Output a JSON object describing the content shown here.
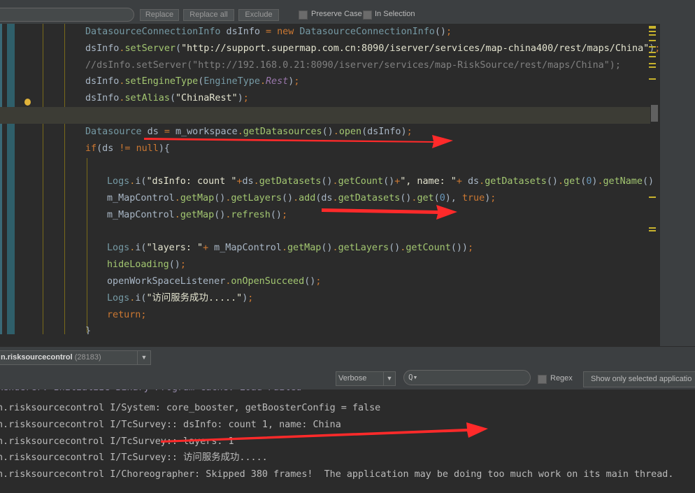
{
  "findbar": {
    "replace_label": "Replace",
    "replace_all_label": "Replace all",
    "exclude_label": "Exclude",
    "preserve_case_label": "Preserve Case",
    "in_selection_label": "In Selection"
  },
  "editor": {
    "lines": [
      [
        "DatasourceConnectionInfo",
        " dsInfo ",
        "=",
        " ",
        "new",
        " ",
        "DatasourceConnectionInfo",
        "()",
        ";"
      ],
      [
        "dsInfo",
        ".",
        "setServer",
        "(",
        "\"http://support.supermap.com.cn:8090/iserver/services/map-china400/rest/maps/China\"",
        ")",
        ";"
      ],
      [
        "//dsInfo.setServer(\"http://192.168.0.21:8090/iserver/services/map-RiskSource/rest/maps/China\");"
      ],
      [
        "dsInfo",
        ".",
        "setEngineType",
        "(",
        "EngineType",
        ".",
        "Rest",
        ")",
        ";"
      ],
      [
        "dsInfo",
        ".",
        "setAlias",
        "(",
        "\"ChinaRest\"",
        ")",
        ";"
      ],
      [],
      [
        "Datasource",
        " ds ",
        "=",
        " m_workspace",
        ".",
        "getDatasources",
        "()",
        ".",
        "open",
        "(dsInfo)",
        ";"
      ],
      [
        "if",
        "(ds ",
        "!=",
        " ",
        "null",
        "){"
      ],
      [],
      [
        "Logs",
        ".",
        "i",
        "(",
        "\"dsInfo: count \"",
        "+",
        "ds",
        ".",
        "getDatasets",
        "()",
        ".",
        "getCount",
        "()",
        "+",
        "\", name: \"",
        "+",
        " ds",
        ".",
        "getDatasets",
        "()",
        ".",
        "get",
        "(",
        "0",
        ")",
        ".",
        "getName",
        "() )"
      ],
      [
        "m_MapControl",
        ".",
        "getMap",
        "()",
        ".",
        "getLayers",
        "()",
        ".",
        "add",
        "(ds",
        ".",
        "getDatasets",
        "()",
        ".",
        "get",
        "(",
        "0",
        "),",
        " ",
        "true",
        ")",
        ";"
      ],
      [
        "m_MapControl",
        ".",
        "getMap",
        "()",
        ".",
        "refresh",
        "()",
        ";"
      ],
      [],
      [
        "Logs",
        ".",
        "i",
        "(",
        "\"layers: \"",
        "+",
        " m_MapControl",
        ".",
        "getMap",
        "()",
        ".",
        "getLayers",
        "()",
        ".",
        "getCount",
        "())",
        ";"
      ],
      [
        "hideLoading",
        "()",
        ";"
      ],
      [
        "openWorkSpaceListener",
        ".",
        "onOpenSucceed",
        "()",
        ";"
      ],
      [
        "Logs",
        ".",
        "i",
        "(",
        "\"访问服务成功.....\"",
        ")",
        ";"
      ],
      [
        "return",
        ";"
      ],
      [
        "}"
      ]
    ]
  },
  "logcat": {
    "process_name": "n.risksourcecontrol",
    "process_pid": "(28183)",
    "level": "Verbose",
    "search_placeholder": "Q▾",
    "regex_label": "Regex",
    "show_only_label": "Show only selected applicatio",
    "partial_line": "Renderer: Initialize Binary Program Cache: Load Failed",
    "lines": [
      "n.risksourcecontrol I/System: core_booster, getBoosterConfig = false",
      "n.risksourcecontrol I/TcSurvey:: dsInfo: count 1, name: China",
      "n.risksourcecontrol I/TcSurvey:: layers: 1",
      "n.risksourcecontrol I/TcSurvey:: 访问服务成功.....",
      "n.risksourcecontrol I/Choreographer: Skipped 380 frames!  The application may be doing too much work on its main thread."
    ]
  },
  "colors": {
    "editor_bg": "#2b2b2b",
    "panel_bg": "#3c3f41",
    "arrow": "#ff2a2a",
    "keyword": "#cc7832",
    "string": "#e4e4cf",
    "method": "#a3c771",
    "class": "#769aa5"
  },
  "icons": [
    "bulb-icon",
    "dropdown-arrow-icon",
    "search-icon",
    "arrow-annotation"
  ]
}
